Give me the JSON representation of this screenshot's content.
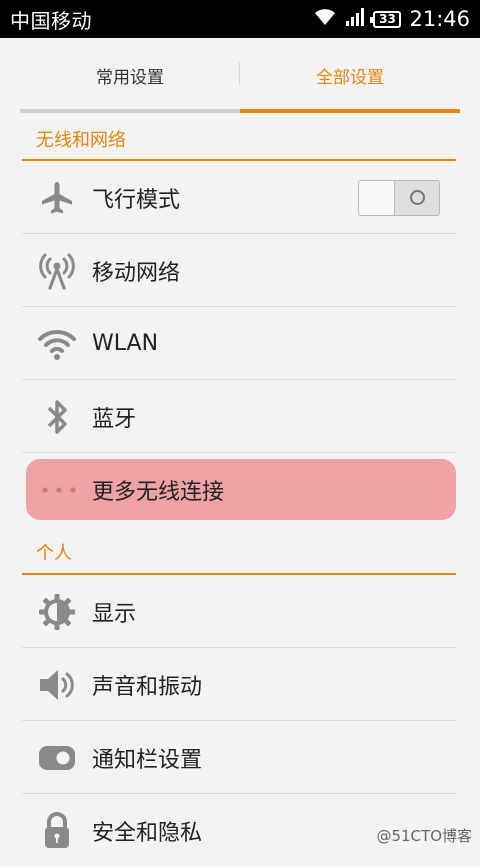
{
  "status_bar": {
    "carrier": "中国移动",
    "battery": "33",
    "time": "21:46"
  },
  "tabs": [
    {
      "label": "常用设置",
      "active": false
    },
    {
      "label": "全部设置",
      "active": true
    }
  ],
  "sections": {
    "wireless": {
      "title": "无线和网络",
      "items": [
        {
          "label": "飞行模式",
          "icon": "airplane-icon",
          "toggle": "off"
        },
        {
          "label": "移动网络",
          "icon": "cell-tower-icon"
        },
        {
          "label": "WLAN",
          "icon": "wifi-icon"
        },
        {
          "label": "蓝牙",
          "icon": "bluetooth-icon"
        },
        {
          "label": "更多无线连接",
          "icon": "more-dots-icon",
          "highlighted": true
        }
      ]
    },
    "personal": {
      "title": "个人",
      "items": [
        {
          "label": "显示",
          "icon": "display-brightness-icon"
        },
        {
          "label": "声音和振动",
          "icon": "speaker-icon"
        },
        {
          "label": "通知栏设置",
          "icon": "notification-toggle-icon"
        },
        {
          "label": "安全和隐私",
          "icon": "lock-icon"
        }
      ]
    }
  },
  "watermark": "@51CTO博客",
  "colors": {
    "accent": "#e6860f",
    "highlight": "#f0a3a4",
    "icon": "#8a8a8a"
  }
}
